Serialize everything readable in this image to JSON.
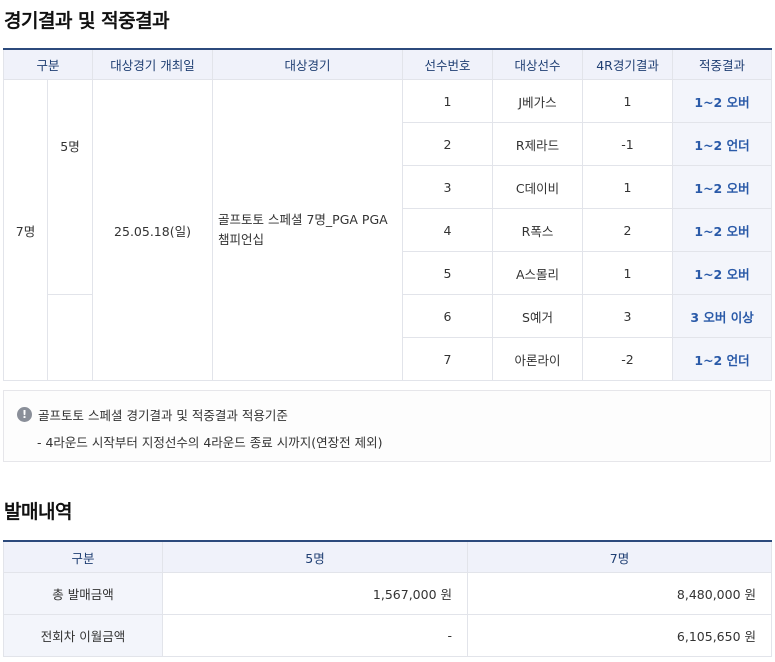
{
  "results_section": {
    "title": "경기결과 및 적중결과",
    "headers": [
      "구분",
      "대상경기 개최일",
      "대상경기",
      "선수번호",
      "대상선수",
      "4R경기결과",
      "적중결과"
    ],
    "group_total": "7명",
    "group_sub": "5명",
    "match_date": "25.05.18(일)",
    "match_name": "골프토토 스페셜 7명_PGA PGA 챔피언십",
    "rows": [
      {
        "no": "1",
        "player": "J베가스",
        "result": "1",
        "hit": "1~2 오버"
      },
      {
        "no": "2",
        "player": "R제라드",
        "result": "-1",
        "hit": "1~2 언더"
      },
      {
        "no": "3",
        "player": "C데이비",
        "result": "1",
        "hit": "1~2 오버"
      },
      {
        "no": "4",
        "player": "R폭스",
        "result": "2",
        "hit": "1~2 오버"
      },
      {
        "no": "5",
        "player": "A스몰리",
        "result": "1",
        "hit": "1~2 오버"
      },
      {
        "no": "6",
        "player": "S예거",
        "result": "3",
        "hit": "3 오버 이상"
      },
      {
        "no": "7",
        "player": "아론라이",
        "result": "-2",
        "hit": "1~2 언더"
      }
    ]
  },
  "notice": {
    "icon": "info-icon",
    "title": "골프토토 스페셜 경기결과 및 적중결과 적용기준",
    "item": "- 4라운드 시작부터 지정선수의 4라운드 종료 시까지(연장전 제외)"
  },
  "sales_section": {
    "title": "발매내역",
    "headers": [
      "구분",
      "5명",
      "7명"
    ],
    "rows": [
      {
        "label": "총 발매금액",
        "v5": "1,567,000 원",
        "v7": "8,480,000 원"
      },
      {
        "label": "전회차 이월금액",
        "v5": "-",
        "v7": "6,105,650 원"
      }
    ]
  }
}
